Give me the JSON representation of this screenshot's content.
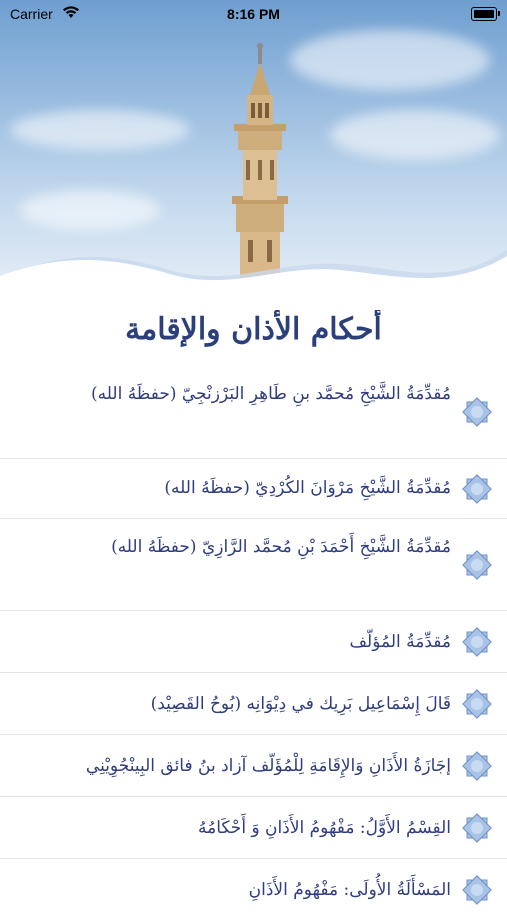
{
  "status_bar": {
    "carrier": "Carrier",
    "time": "8:16 PM"
  },
  "page": {
    "title": "أحكام الأذان والإقامة"
  },
  "colors": {
    "title": "#2b3f7a",
    "item_text": "#2f3d80",
    "icon_fill": "#a9c3e6",
    "icon_stroke": "#6f90c8",
    "divider": "#e6e6e6"
  },
  "list": {
    "icon": "star-octagon-icon",
    "items": [
      {
        "label": "مُقدِّمَةُ الشَّيْخِ مُحمَّد بنِ طَاهِرِ البَرْزنْجِيّ (حفظَهُ الله)"
      },
      {
        "label": "مُقدِّمَةُ الشَّيْخِ مَرْوَانَ الكُرْدِيّ (حفظَهُ الله)"
      },
      {
        "label": "مُقدِّمَةُ الشَّيْخِ أَحْمَدَ بْنِ مُحمَّد الرَّازِيّ (حفظَهُ الله)"
      },
      {
        "label": "مُقدِّمَةُ المُؤلّف"
      },
      {
        "label": "قَالَ إِسْمَاعِيل بَرِيك في دِيْوَانِه (بُوحُ القَصِيْد)"
      },
      {
        "label": "إجَازَةُ الأَذَانِ وَالإِقَامَةِ لِلْمُؤَلّف آزاد بنُ فائق البِينْجُوِيْنِي"
      },
      {
        "label": "القِسْمُ الأَوَّلُ: مَفْهُومُ الأَذَانِ وَ أَحْكَامُهُ"
      },
      {
        "label": "المَسْأَلَةُ الأُولَى: مَفْهُومُ الأَذَانِ"
      }
    ]
  }
}
